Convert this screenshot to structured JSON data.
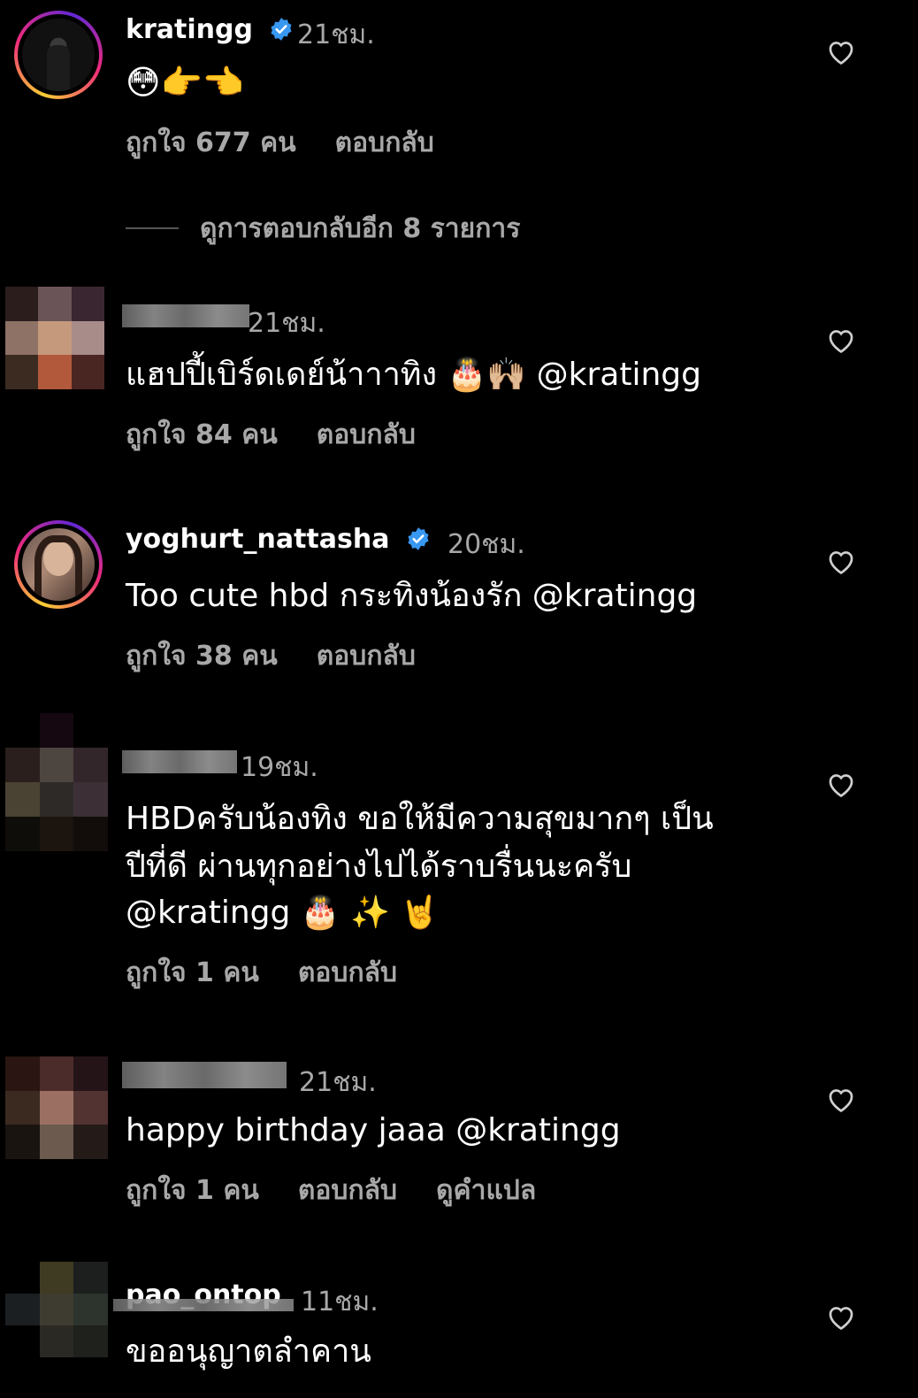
{
  "comments": [
    {
      "username": "kratingg",
      "verified": true,
      "time": "21ชม.",
      "text": "😳👉👈",
      "likes": "ถูกใจ 677 คน",
      "reply": "ตอบกลับ",
      "view_replies": "ดูการตอบกลับอีก 8 รายการ"
    },
    {
      "username_blurred": "...",
      "time": "21ชม.",
      "text": "แฮปปี้เบิร์ดเดย์น้าาาทิง 🎂🙌🏼 @kratingg",
      "likes": "ถูกใจ 84 คน",
      "reply": "ตอบกลับ"
    },
    {
      "username": "yoghurt_nattasha",
      "verified": true,
      "time": "20ชม.",
      "text": "Too cute hbd กระทิงน้องรัก @kratingg",
      "likes": "ถูกใจ 38 คน",
      "reply": "ตอบกลับ"
    },
    {
      "time": "19ชม.",
      "text_lines": [
        "HBDครับน้องทิง ขอให้มีความสุขมากๆ เป็น",
        "ปีที่ดี ผ่านทุกอย่างไปได้ราบรื่นนะครับ",
        "@kratingg 🎂 ✨ 🤘"
      ],
      "likes": "ถูกใจ 1 คน",
      "reply": "ตอบกลับ"
    },
    {
      "time": "21ชม.",
      "text": "happy birthday jaaa @kratingg",
      "likes": "ถูกใจ 1 คน",
      "reply": "ตอบกลับ",
      "translate": "ดูคำแปล"
    },
    {
      "username": "pao_ontop",
      "time": "11ชม.",
      "text": "ขออนุญาตลำคาน"
    }
  ],
  "colors": {
    "background": "#000000",
    "primary_text": "#ffffff",
    "secondary_text": "#a8a8a8",
    "verified_blue": "#3897f0"
  },
  "icons": [
    "verified-badge-icon",
    "heart-outline-icon"
  ]
}
